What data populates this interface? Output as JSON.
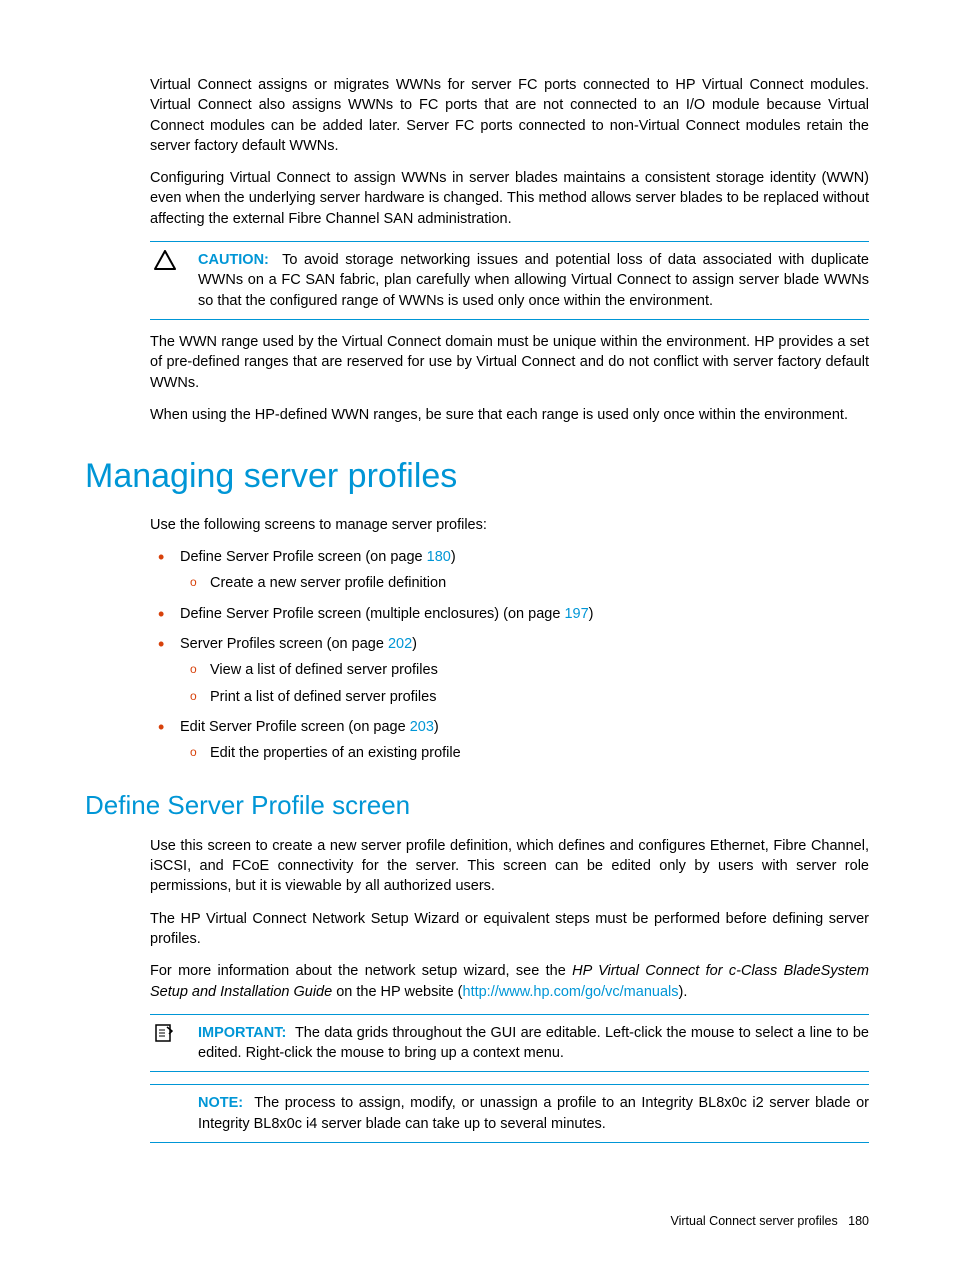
{
  "p1": "Virtual Connect assigns or migrates WWNs for server FC ports connected to HP Virtual Connect modules. Virtual Connect also assigns WWNs to FC ports that are not connected to an I/O module because Virtual Connect modules can be added later. Server FC ports connected to non-Virtual Connect modules retain the server factory default WWNs.",
  "p2": "Configuring Virtual Connect to assign WWNs in server blades maintains a consistent storage identity (WWN) even when the underlying server hardware is changed. This method allows server blades to be replaced without affecting the external Fibre Channel SAN administration.",
  "caution": {
    "label": "CAUTION:",
    "text": "To avoid storage networking issues and potential loss of data associated with duplicate WWNs on a FC SAN fabric, plan carefully when allowing Virtual Connect to assign server blade WWNs so that the configured range of WWNs is used only once within the environment."
  },
  "p3": "The WWN range used by the Virtual Connect domain must be unique within the environment. HP provides a set of pre-defined ranges that are reserved for use by Virtual Connect and do not conflict with server factory default WWNs.",
  "p4": "When using the HP-defined WWN ranges, be sure that each range is used only once within the environment.",
  "h1": "Managing server profiles",
  "p5": "Use the following screens to manage server profiles:",
  "list": {
    "i1a": "Define Server Profile screen (on page ",
    "i1link": "180",
    "i1b": ")",
    "i1_sub1": "Create a new server profile definition",
    "i2a": "Define Server Profile screen (multiple enclosures) (on page ",
    "i2link": "197",
    "i2b": ")",
    "i3a": "Server Profiles screen (on page ",
    "i3link": "202",
    "i3b": ")",
    "i3_sub1": "View a list of defined server profiles",
    "i3_sub2": "Print a list of defined server profiles",
    "i4a": "Edit Server Profile screen (on page ",
    "i4link": "203",
    "i4b": ")",
    "i4_sub1": "Edit the properties of an existing profile"
  },
  "h2": "Define Server Profile screen",
  "p6": "Use this screen to create a new server profile definition, which defines and configures Ethernet, Fibre Channel, iSCSI, and FCoE connectivity for the server. This screen can be edited only by users with server role permissions, but it is viewable by all authorized users.",
  "p7": "The HP Virtual Connect Network Setup Wizard or equivalent steps must be performed before defining server profiles.",
  "p8a": "For more information about the network setup wizard, see the ",
  "p8italic": "HP Virtual Connect for c-Class BladeSystem Setup and Installation Guide",
  "p8b": " on the HP website (",
  "p8link": "http://www.hp.com/go/vc/manuals",
  "p8c": ").",
  "important": {
    "label": "IMPORTANT:",
    "text": "The data grids throughout the GUI are editable. Left-click the mouse to select a line to be edited. Right-click the mouse to bring up a context menu."
  },
  "note": {
    "label": "NOTE:",
    "text": "The process to assign, modify, or unassign a profile to an Integrity BL8x0c i2 server blade or Integrity BL8x0c i4 server blade can take up to several minutes."
  },
  "footer": {
    "text": "Virtual Connect server profiles",
    "page": "180"
  }
}
